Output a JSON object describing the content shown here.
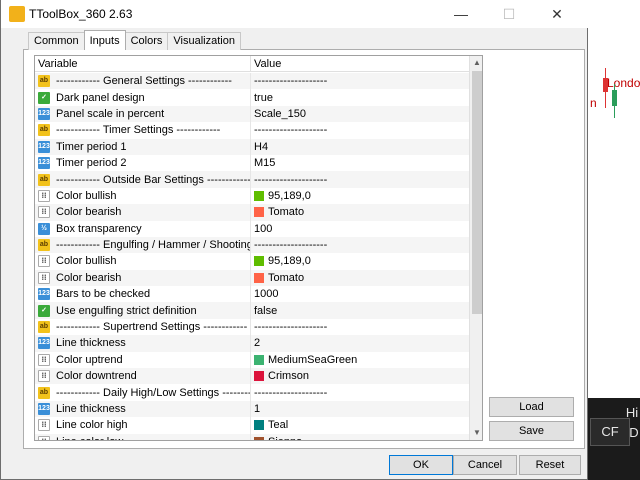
{
  "window": {
    "title": "TToolBox_360 2.63",
    "controls": [
      "—",
      "☐",
      "✕"
    ]
  },
  "tabs": [
    {
      "label": "Common"
    },
    {
      "label": "Inputs",
      "active": true
    },
    {
      "label": "Colors"
    },
    {
      "label": "Visualization"
    }
  ],
  "grid": {
    "headers": {
      "variable": "Variable",
      "value": "Value"
    },
    "rows": [
      {
        "type": "ab",
        "name": "------------ General Settings ------------",
        "value": "--------------------"
      },
      {
        "type": "bool",
        "name": "Dark panel design",
        "value": "true"
      },
      {
        "type": "int",
        "name": "Panel scale in percent",
        "value": "Scale_150"
      },
      {
        "type": "ab",
        "name": "------------ Timer Settings ------------",
        "value": "--------------------"
      },
      {
        "type": "int",
        "name": "Timer period 1",
        "value": "H4"
      },
      {
        "type": "int",
        "name": "Timer period 2",
        "value": "M15"
      },
      {
        "type": "ab",
        "name": "------------ Outside Bar Settings ------------",
        "value": "--------------------"
      },
      {
        "type": "clr",
        "name": "Color bullish",
        "value": "95,189,0",
        "swatch": "#5fbd00"
      },
      {
        "type": "clr",
        "name": "Color bearish",
        "value": "Tomato",
        "swatch": "#ff6347"
      },
      {
        "type": "dbl",
        "name": "Box transparency",
        "value": "100"
      },
      {
        "type": "ab",
        "name": "------------ Engulfing / Hammer / Shooting Star ...",
        "value": "--------------------"
      },
      {
        "type": "clr",
        "name": "Color bullish",
        "value": "95,189,0",
        "swatch": "#5fbd00"
      },
      {
        "type": "clr",
        "name": "Color bearish",
        "value": "Tomato",
        "swatch": "#ff6347"
      },
      {
        "type": "int",
        "name": "Bars to be checked",
        "value": "1000"
      },
      {
        "type": "bool",
        "name": "Use engulfing strict definition",
        "value": "false"
      },
      {
        "type": "ab",
        "name": "------------ Supertrend Settings ------------",
        "value": "--------------------"
      },
      {
        "type": "int",
        "name": "Line thickness",
        "value": "2"
      },
      {
        "type": "clr",
        "name": "Color uptrend",
        "value": "MediumSeaGreen",
        "swatch": "#3cb371"
      },
      {
        "type": "clr",
        "name": "Color downtrend",
        "value": "Crimson",
        "swatch": "#dc143c"
      },
      {
        "type": "ab",
        "name": "------------ Daily High/Low Settings ------------",
        "value": "--------------------"
      },
      {
        "type": "int",
        "name": "Line thickness",
        "value": "1"
      },
      {
        "type": "clr",
        "name": "Line color high",
        "value": "Teal",
        "swatch": "#008080"
      },
      {
        "type": "clr",
        "name": "Line color low",
        "value": "Sienna",
        "swatch": "#a0522d"
      }
    ]
  },
  "type_icons": {
    "ab": "ab",
    "bool": "✓",
    "int": "123",
    "dbl": "½",
    "clr": "⁝⁝"
  },
  "side_buttons": {
    "load": "Load",
    "save": "Save"
  },
  "footer_buttons": {
    "ok": "OK",
    "cancel": "Cancel",
    "reset": "Reset"
  },
  "background": {
    "label_top": "London",
    "label_mid": "n",
    "label_left": "ndon",
    "btn_hi": "Hi",
    "btn_cf": "CF",
    "btn_d": "D"
  }
}
